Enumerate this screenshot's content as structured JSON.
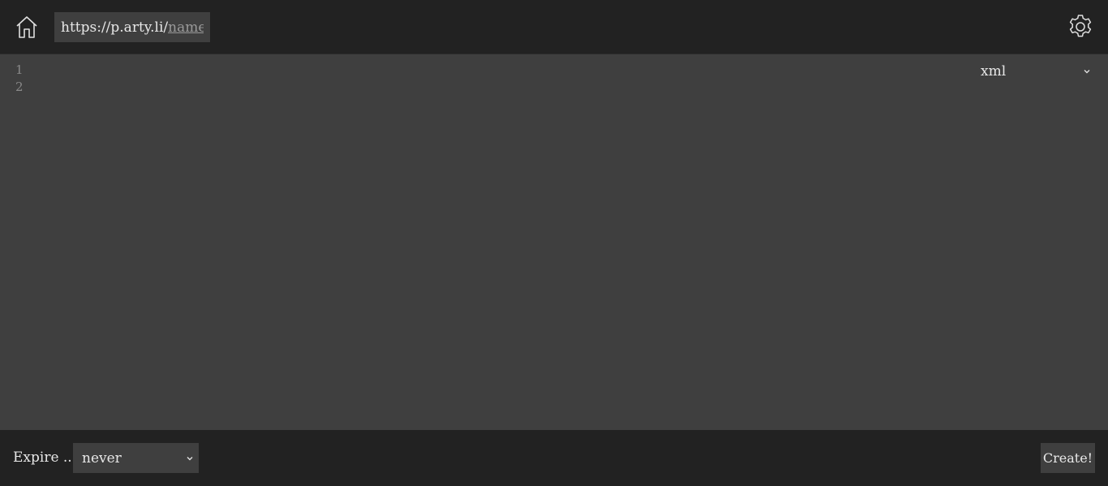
{
  "header": {
    "home_icon": "home-icon",
    "url_prefix": "https://p.arty.li/",
    "name_placeholder": "name",
    "settings_icon": "gear-icon"
  },
  "editor": {
    "line_numbers": [
      "1",
      "2"
    ],
    "content": "",
    "language": "xml"
  },
  "footer": {
    "expire_label": "Expire ...",
    "expire_value": "never",
    "create_label": "Create!"
  },
  "colors": {
    "header_bg": "#222222",
    "editor_bg": "#3f3f3f",
    "text": "#e8e8e8",
    "muted": "#8a8a8a"
  }
}
